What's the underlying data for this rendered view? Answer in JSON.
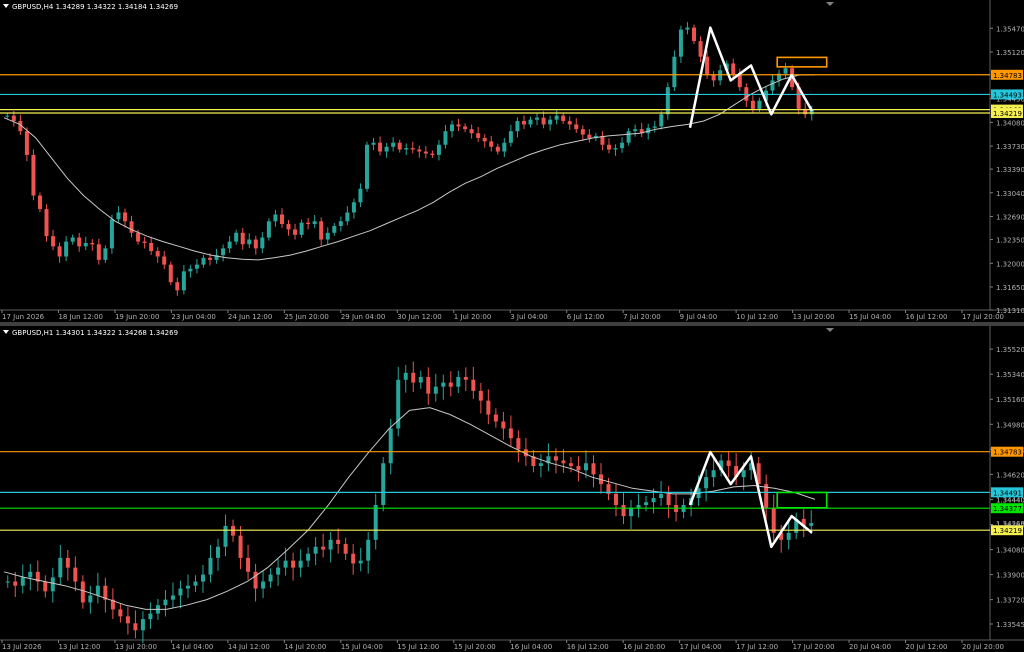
{
  "colors": {
    "bull": "#26a69a",
    "bear": "#ef5350",
    "orange": "#ff9800",
    "cyan": "#26c6da",
    "yellow": "#f5f052",
    "green": "#00e600",
    "white": "#ffffff",
    "ma": "#c8c8c8",
    "axis": "#b0b0b0"
  },
  "charts": [
    {
      "id": "top",
      "header": "GBPUSD,H4  1.34289 1.34322 1.34184 1.34269",
      "y_range": [
        1.3131,
        1.3571
      ],
      "y_ticks": [
        "1.35470",
        "1.35120",
        "1.34430",
        "1.34080",
        "1.33730",
        "1.33390",
        "1.33040",
        "1.32690",
        "1.32350",
        "1.32000",
        "1.31650",
        "1.31310"
      ],
      "x_labels": [
        "17 Jun 2026",
        "18 Jun 12:00",
        "19 Jun 20:00",
        "23 Jun 04:00",
        "24 Jun 12:00",
        "25 Jun 20:00",
        "29 Jun 04:00",
        "30 Jun 12:00",
        "1 Jul 20:00",
        "3 Jul 04:00",
        "6 Jul 12:00",
        "7 Jul 20:00",
        "9 Jul 04:00",
        "10 Jul 12:00",
        "13 Jul 20:00",
        "15 Jul 04:00",
        "16 Jul 12:00",
        "17 Jul 20:00"
      ],
      "price_levels": [
        {
          "name": "resistance",
          "value": 1.34783,
          "label": "1.34783",
          "color": "orange"
        },
        {
          "name": "cyan",
          "value": 1.34493,
          "label": "1.34493",
          "color": "cyan"
        },
        {
          "name": "yellow-upper",
          "value": 1.34269,
          "label": "1.34269",
          "color": "yellow"
        },
        {
          "name": "yellow-lower",
          "value": 1.34219,
          "label": "1.34219",
          "color": "yellow"
        }
      ],
      "current_price": "1.34269",
      "path": [
        1.34,
        1.3548,
        1.347,
        1.3492,
        1.342,
        1.3478,
        1.3425
      ],
      "close_points": [
        1.3418,
        1.341,
        1.3395,
        1.336,
        1.33,
        1.328,
        1.324,
        1.3225,
        1.321,
        1.3232,
        1.3238,
        1.3225,
        1.323,
        1.3228,
        1.3205,
        1.3222,
        1.3265,
        1.3275,
        1.3262,
        1.3245,
        1.3232,
        1.323,
        1.3218,
        1.321,
        1.3198,
        1.3172,
        1.316,
        1.3188,
        1.3192,
        1.3198,
        1.3208,
        1.3205,
        1.3212,
        1.3222,
        1.3232,
        1.3245,
        1.3228,
        1.3235,
        1.3222,
        1.3238,
        1.3262,
        1.3272,
        1.3258,
        1.325,
        1.3242,
        1.326,
        1.3258,
        1.3262,
        1.3235,
        1.3245,
        1.3255,
        1.3262,
        1.3275,
        1.329,
        1.331,
        1.3375,
        1.3378,
        1.3365,
        1.3372,
        1.3378,
        1.3368,
        1.337,
        1.3368,
        1.3365,
        1.3362,
        1.336,
        1.3375,
        1.3395,
        1.3405,
        1.3402,
        1.3398,
        1.3392,
        1.3385,
        1.338,
        1.3372,
        1.3365,
        1.3378,
        1.3395,
        1.341,
        1.3405,
        1.3412,
        1.3415,
        1.3405,
        1.3412,
        1.3418,
        1.341,
        1.3405,
        1.3398,
        1.339,
        1.3385,
        1.3388,
        1.3375,
        1.3368,
        1.337,
        1.3378,
        1.3395,
        1.3398,
        1.3392,
        1.34,
        1.3402,
        1.342,
        1.346,
        1.3505,
        1.3545,
        1.3548,
        1.3528,
        1.3505,
        1.3478,
        1.347,
        1.3485,
        1.3495,
        1.3478,
        1.346,
        1.344,
        1.3428,
        1.344,
        1.3455,
        1.347,
        1.348,
        1.3488,
        1.346,
        1.3428,
        1.342,
        1.3427
      ],
      "ma_points": [
        1.3415,
        1.3405,
        1.3385,
        1.3355,
        1.3325,
        1.33,
        1.328,
        1.3262,
        1.325,
        1.324,
        1.3232,
        1.3225,
        1.3218,
        1.3212,
        1.3208,
        1.3206,
        1.3205,
        1.3208,
        1.3212,
        1.3218,
        1.3225,
        1.3232,
        1.324,
        1.3248,
        1.3258,
        1.3268,
        1.3278,
        1.329,
        1.3305,
        1.3318,
        1.3328,
        1.334,
        1.335,
        1.336,
        1.3368,
        1.3375,
        1.338,
        1.3385,
        1.3388,
        1.339,
        1.3392,
        1.3398,
        1.3402,
        1.3405,
        1.341,
        1.342,
        1.3435,
        1.345,
        1.3462,
        1.3472,
        1.3478,
        1.3478
      ],
      "box": {
        "from": 0.78,
        "to": 0.83,
        "lo": 1.349,
        "hi": 1.3504,
        "color": "orange"
      }
    },
    {
      "id": "bottom",
      "header": "GBPUSD,H1  1.34301 1.34322 1.34268 1.34269",
      "y_range": [
        1.3343,
        1.356
      ],
      "y_ticks": [
        "1.35520",
        "1.35340",
        "1.35160",
        "1.34980",
        "1.34800",
        "1.34620",
        "1.34440",
        "1.34260",
        "1.34080",
        "1.33900",
        "1.33720",
        "1.33545"
      ],
      "x_labels": [
        "13 Jul 2026",
        "13 Jul 12:00",
        "13 Jul 20:00",
        "14 Jul 04:00",
        "14 Jul 12:00",
        "14 Jul 20:00",
        "15 Jul 04:00",
        "15 Jul 12:00",
        "15 Jul 20:00",
        "16 Jul 04:00",
        "16 Jul 12:00",
        "16 Jul 20:00",
        "17 Jul 04:00",
        "17 Jul 12:00",
        "17 Jul 20:00",
        "20 Jul 04:00",
        "20 Jul 12:00",
        "20 Jul 20:00"
      ],
      "price_levels": [
        {
          "name": "resistance",
          "value": 1.34783,
          "label": "1.34783",
          "color": "orange"
        },
        {
          "name": "cyan",
          "value": 1.34491,
          "label": "1.34491",
          "color": "cyan"
        },
        {
          "name": "green",
          "value": 1.34377,
          "label": "1.34377",
          "color": "green"
        },
        {
          "name": "yellow",
          "value": 1.34219,
          "label": "1.34219",
          "color": "yellow"
        }
      ],
      "extra_labels": [
        "1.34440",
        "1.34269"
      ],
      "current_price": "1.34269",
      "path": [
        1.344,
        1.3478,
        1.3455,
        1.3475,
        1.341,
        1.3432,
        1.342
      ],
      "close_points": [
        1.3385,
        1.3382,
        1.3388,
        1.3392,
        1.3385,
        1.3378,
        1.3388,
        1.3402,
        1.3395,
        1.3385,
        1.337,
        1.3375,
        1.3382,
        1.3372,
        1.3365,
        1.336,
        1.3355,
        1.335,
        1.3358,
        1.3362,
        1.3368,
        1.3372,
        1.3375,
        1.338,
        1.3382,
        1.3385,
        1.339,
        1.3402,
        1.341,
        1.3425,
        1.3418,
        1.3402,
        1.3392,
        1.338,
        1.3385,
        1.339,
        1.3395,
        1.34,
        1.3395,
        1.34,
        1.3405,
        1.341,
        1.3408,
        1.3415,
        1.3412,
        1.3405,
        1.3398,
        1.34,
        1.3415,
        1.344,
        1.347,
        1.3495,
        1.353,
        1.3535,
        1.3528,
        1.3532,
        1.352,
        1.3525,
        1.3528,
        1.3525,
        1.3532,
        1.353,
        1.3522,
        1.3515,
        1.3505,
        1.35,
        1.3495,
        1.3488,
        1.348,
        1.3475,
        1.3468,
        1.347,
        1.3475,
        1.3472,
        1.347,
        1.3468,
        1.3465,
        1.347,
        1.3462,
        1.3455,
        1.3448,
        1.344,
        1.3432,
        1.3438,
        1.344,
        1.3442,
        1.3445,
        1.3448,
        1.344,
        1.3435,
        1.344,
        1.3445,
        1.3452,
        1.346,
        1.3465,
        1.3472,
        1.3468,
        1.346,
        1.3465,
        1.347,
        1.3455,
        1.3438,
        1.342,
        1.3415,
        1.342,
        1.343,
        1.3425,
        1.3427
      ],
      "ma_points": [
        1.3392,
        1.3388,
        1.3385,
        1.3382,
        1.3378,
        1.3373,
        1.3368,
        1.3365,
        1.3365,
        1.3368,
        1.3372,
        1.3378,
        1.3385,
        1.3395,
        1.3408,
        1.3422,
        1.344,
        1.346,
        1.3478,
        1.3495,
        1.3508,
        1.351,
        1.3505,
        1.3498,
        1.349,
        1.3482,
        1.3475,
        1.347,
        1.3466,
        1.346,
        1.3456,
        1.3452,
        1.345,
        1.3448,
        1.3448,
        1.345,
        1.3453,
        1.3454,
        1.3452,
        1.3449,
        1.3444
      ],
      "box": {
        "from": 0.78,
        "to": 0.83,
        "lo": 1.3438,
        "hi": 1.3449,
        "color": "green"
      }
    }
  ]
}
